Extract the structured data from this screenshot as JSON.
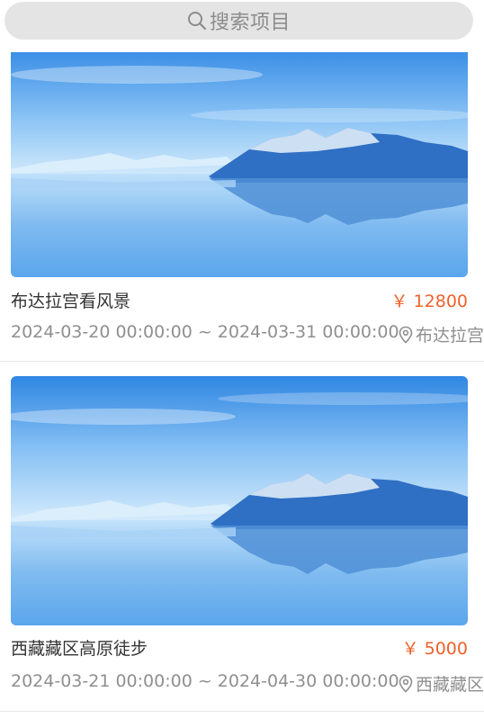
{
  "search": {
    "placeholder": "搜索项目",
    "icon": "search-icon"
  },
  "projects": [
    {
      "title": "布达拉宫看风景",
      "price": "￥ 12800",
      "date_range": "2024-03-20 00:00:00 ~ 2024-03-31 00:00:00",
      "location": "布达拉宫",
      "location_icon": "location-pin-icon",
      "image": "lake-mountain-image"
    },
    {
      "title": "西藏藏区高原徒步",
      "price": "￥ 5000",
      "date_range": "2024-03-21 00:00:00 ~ 2024-04-30 00:00:00",
      "location": "西藏藏区",
      "location_icon": "location-pin-icon",
      "image": "lake-mountain-image"
    }
  ],
  "colors": {
    "price": "#f0612a",
    "search_bg": "#e4e4e4",
    "meta_text": "#8f8f8f",
    "title_text": "#333333",
    "sky_top": "#3b8fe6",
    "mountain": "#2f6fc4"
  }
}
